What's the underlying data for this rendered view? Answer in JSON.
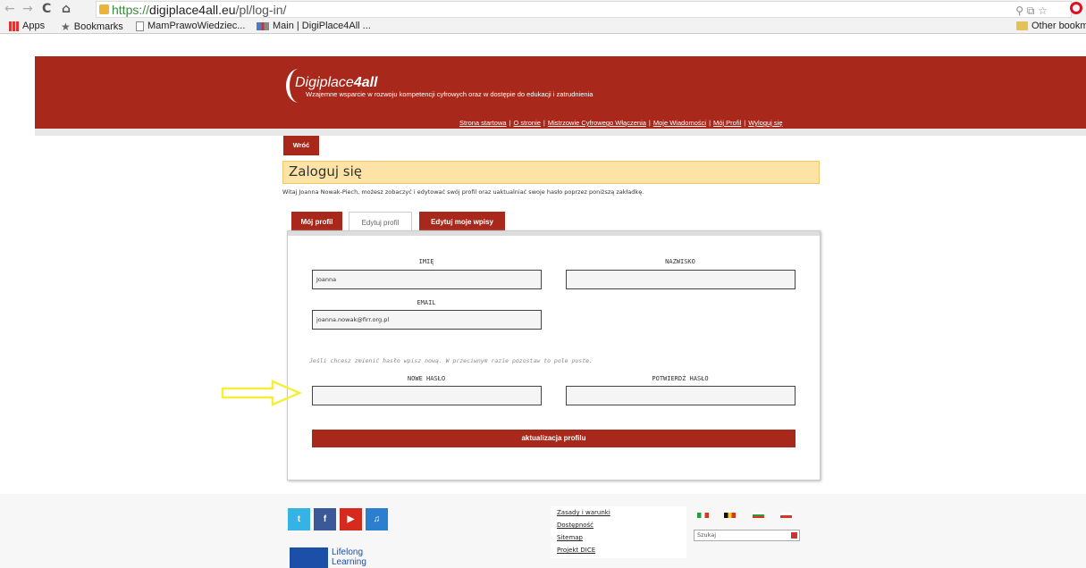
{
  "browser": {
    "url_proto": "https://",
    "url_host": "digiplace4all.eu",
    "url_path": "/pl/log-in/",
    "bookmarks": [
      {
        "label": "Apps"
      },
      {
        "label": "Bookmarks"
      },
      {
        "label": "MamPrawoWiedziec..."
      },
      {
        "label": "Main | DigiPlace4All ..."
      }
    ],
    "other_bookmarks": "Other bookm"
  },
  "header": {
    "logo_plain": "Digiplace",
    "logo_bold": "4all",
    "tagline": "Wzajemne wsparcie w rozwoju kompetencji cyfrowych oraz w dostępie do edukacji i zatrudnienia",
    "nav": [
      {
        "label": "Strona startowa"
      },
      {
        "label": "O stronie"
      },
      {
        "label": "Mistrzowie Cyfrowego Włączenia"
      },
      {
        "label": "Moje Wiadomości"
      },
      {
        "label": "Mój Profil"
      },
      {
        "label": "Wyloguj się"
      }
    ],
    "nav_separator": "|"
  },
  "main": {
    "back_label": "Wróć",
    "title": "Zaloguj się",
    "intro": "Witaj Joanna Nowak-Piech, możesz zobaczyć i edytować swój profil oraz uaktualniać swoje hasło poprzez poniższą zakładkę.",
    "tabs": [
      {
        "label": "Mój profil",
        "active": false
      },
      {
        "label": "Edytuj profil",
        "active": true
      },
      {
        "label": "Edytuj moje wpisy",
        "active": false
      }
    ]
  },
  "form": {
    "first_name_label": "IMIĘ",
    "first_name_value": "Joanna",
    "last_name_label": "NAZWISKO",
    "last_name_value": "",
    "email_label": "EMAIL",
    "email_value": "joanna.nowak@firr.org.pl",
    "password_hint": "Jeśli chcesz zmienić hasło wpisz nową. W przeciwnym razie pozostaw to pole puste.",
    "new_password_label": "NOWE HASŁO",
    "confirm_password_label": "POTWIERDŹ HASŁO",
    "submit_label": "aktualizacja profilu"
  },
  "footer": {
    "links": [
      {
        "label": "Zasady i warunki"
      },
      {
        "label": "Dostępność"
      },
      {
        "label": "Sitemap"
      },
      {
        "label": "Projekt DICE"
      }
    ],
    "search_placeholder": "Szukaj",
    "eu_text_line1": "Lifelong",
    "eu_text_line2": "Learning"
  },
  "colors": {
    "brand_red": "#a8281c",
    "title_bg": "#fde4a6",
    "annotation_arrow": "#f5ef3a"
  }
}
